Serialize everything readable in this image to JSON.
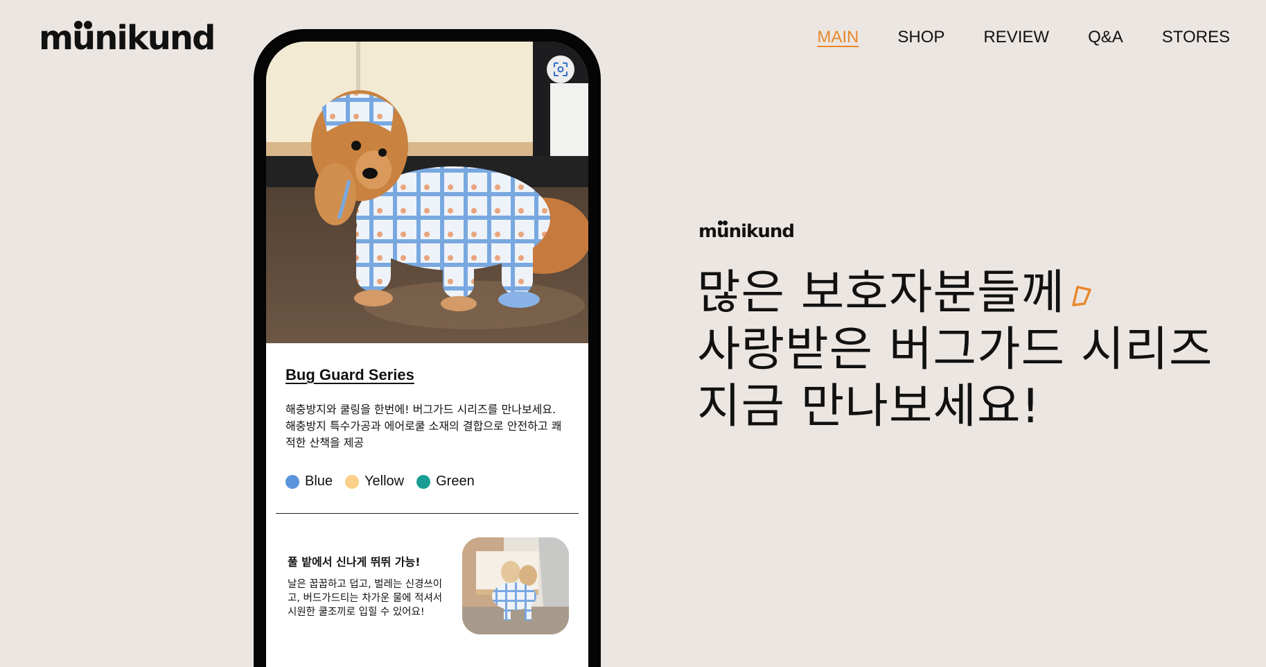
{
  "brand": {
    "logo_text_pre": "m",
    "logo_text_u": "u",
    "logo_text_post": "nikund"
  },
  "nav": {
    "items": [
      {
        "label": "MAIN",
        "active": true
      },
      {
        "label": "SHOP",
        "active": false
      },
      {
        "label": "REVIEW",
        "active": false
      },
      {
        "label": "Q&A",
        "active": false
      },
      {
        "label": "STORES",
        "active": false
      }
    ]
  },
  "product": {
    "title": "Bug Guard Series",
    "description": "해충방지와 쿨링을 한번에! 버그가드 시리즈를 만나보세요. 해충방지 특수가공과 에어로쿨 소재의 결합으로 안전하고 쾌적한 산책을 제공",
    "colors": [
      {
        "label": "Blue",
        "hex": "#5b94dd"
      },
      {
        "label": "Yellow",
        "hex": "#fdd08a"
      },
      {
        "label": "Green",
        "hex": "#1a9e93"
      }
    ]
  },
  "feature": {
    "title": "풀 밭에서 신나게 뛰뛰 가능!",
    "description": "날은 꿉꿉하고 덥고, 벌레는 신경쓰이고, 버드가드티는 차가운 물에 적셔서 시원한 쿨조끼로 입힐 수 있어요!"
  },
  "hero": {
    "lines": [
      "많은 보호자분들께",
      "사랑받은 버그가드 시리즈",
      "지금 만나보세요!"
    ]
  },
  "colors": {
    "accent": "#e8882c",
    "background": "#ece6e2"
  },
  "icons": {
    "scan": "scan-focus-icon",
    "sparkle": "sparkle-icon"
  }
}
